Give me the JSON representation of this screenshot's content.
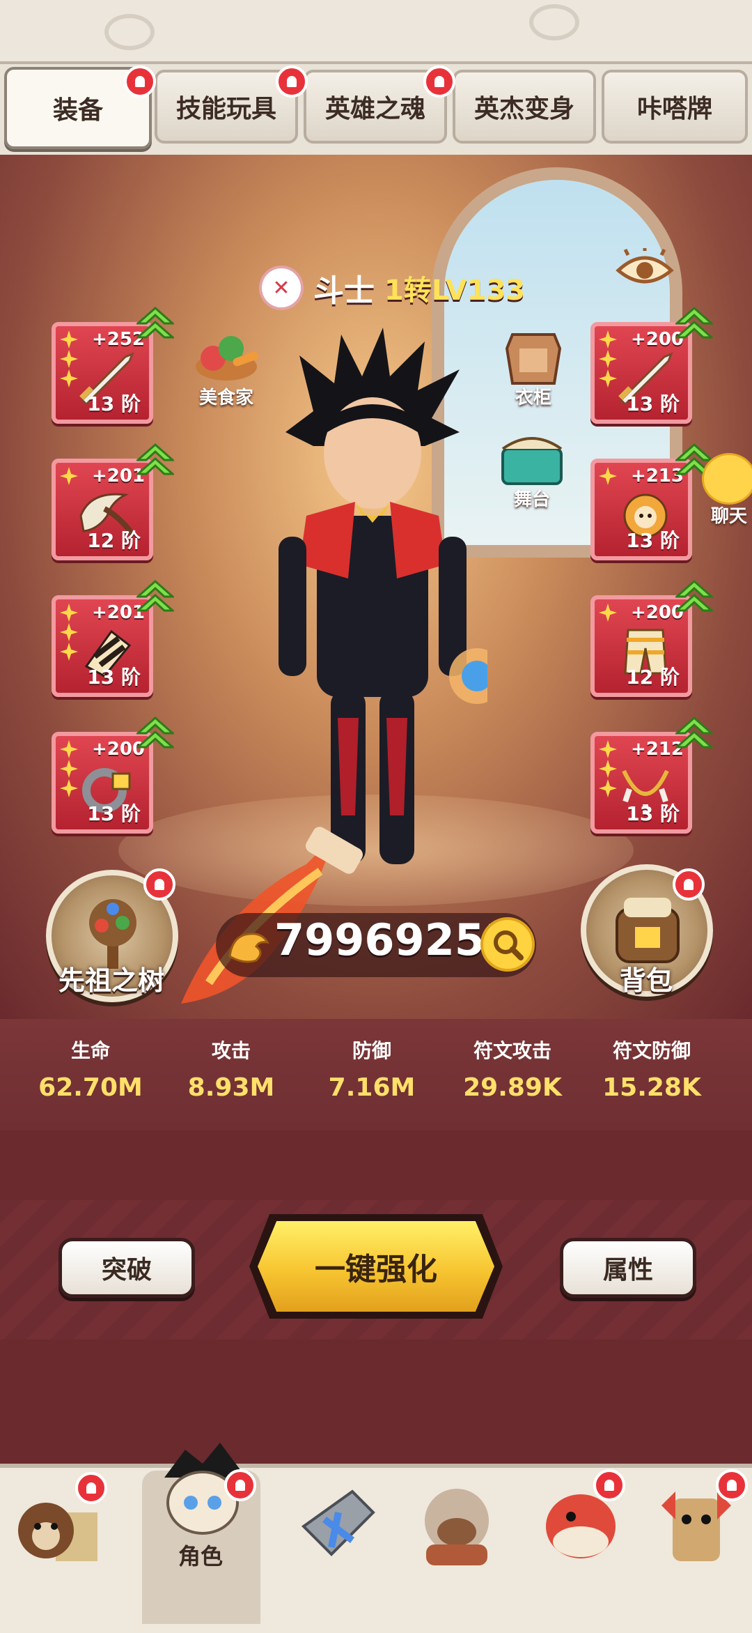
{
  "tabs": [
    {
      "label": "装备",
      "active": true,
      "badge": true
    },
    {
      "label": "技能玩具",
      "active": false,
      "badge": true
    },
    {
      "label": "英雄之魂",
      "active": false,
      "badge": true
    },
    {
      "label": "英杰变身",
      "active": false,
      "badge": false
    },
    {
      "label": "咔嗒牌",
      "active": false,
      "badge": false
    }
  ],
  "character": {
    "class_name": "斗士",
    "level": "1转LV133"
  },
  "left_slots": [
    {
      "bonus": "+252",
      "tier": "13 阶",
      "stars": 3
    },
    {
      "bonus": "+201",
      "tier": "12 阶",
      "stars": 1
    },
    {
      "bonus": "+201",
      "tier": "13 阶",
      "stars": 3
    },
    {
      "bonus": "+200",
      "tier": "13 阶",
      "stars": 3
    }
  ],
  "right_slots": [
    {
      "bonus": "+200",
      "tier": "13 阶",
      "stars": 3
    },
    {
      "bonus": "+213",
      "tier": "13 阶",
      "stars": 1
    },
    {
      "bonus": "+200",
      "tier": "12 阶",
      "stars": 1
    },
    {
      "bonus": "+212",
      "tier": "13 阶",
      "stars": 3
    }
  ],
  "side_icons": {
    "gourmet": "美食家",
    "wardrobe": "衣柜",
    "stage": "舞台",
    "chat": "聊天"
  },
  "ancestor_tree": "先祖之树",
  "backpack": "背包",
  "currency": "79969253",
  "stats": [
    {
      "name": "生命",
      "value": "62.70M"
    },
    {
      "name": "攻击",
      "value": "8.93M"
    },
    {
      "name": "防御",
      "value": "7.16M"
    },
    {
      "name": "符文攻击",
      "value": "29.89K"
    },
    {
      "name": "符文防御",
      "value": "15.28K"
    }
  ],
  "actions": {
    "breakthrough": "突破",
    "one_click_enhance": "一键强化",
    "attributes": "属性"
  },
  "bottom_nav": [
    {
      "label": "",
      "active": false,
      "icon": "bear-shop-icon"
    },
    {
      "label": "角色",
      "active": true,
      "icon": "character-icon"
    },
    {
      "label": "",
      "active": false,
      "icon": "sword-icon"
    },
    {
      "label": "",
      "active": false,
      "icon": "monkey-icon"
    },
    {
      "label": "",
      "active": false,
      "icon": "dino-icon"
    },
    {
      "label": "",
      "active": false,
      "icon": "totem-icon"
    }
  ],
  "colors": {
    "slot_red": "#d93945",
    "stat_gold": "#ffe06a",
    "level_gold": "#ffe25a",
    "badge_red": "#e8323a"
  }
}
